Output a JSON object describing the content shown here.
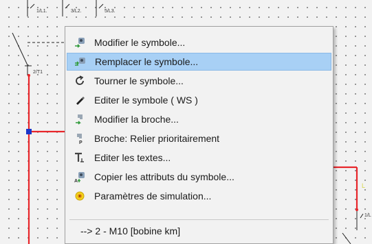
{
  "schematic": {
    "pin_labels": [
      "1/L1.",
      "3/L2.",
      "5/L3.",
      "2/T1",
      "1/L"
    ],
    "partial_label": "L",
    "colors": {
      "wire": "#e8252a",
      "junction": "#1a35c9",
      "line": "#222222"
    }
  },
  "context_menu": {
    "items": [
      {
        "label": "Modifier le symbole...",
        "icon": "modify-symbol-icon"
      },
      {
        "label": "Remplacer le symbole...",
        "icon": "replace-symbol-icon",
        "highlighted": true
      },
      {
        "label": "Tourner le symbole...",
        "icon": "rotate-icon"
      },
      {
        "label": "Editer le symbole ( WS )",
        "icon": "pen-icon"
      },
      {
        "label": "Modifier la broche...",
        "icon": "modify-pin-icon"
      },
      {
        "label": "Broche: Relier prioritairement",
        "icon": "pin-priority-icon"
      },
      {
        "label": "Editer les textes...",
        "icon": "text-edit-icon"
      },
      {
        "label": "Copier les attributs du symbole...",
        "icon": "copy-attributes-icon"
      },
      {
        "label": "Paramètres de simulation...",
        "icon": "simulation-icon"
      }
    ],
    "footer": "--> 2 - M10 [bobine km]",
    "colors": {
      "highlight": "#a8d0f5"
    }
  }
}
